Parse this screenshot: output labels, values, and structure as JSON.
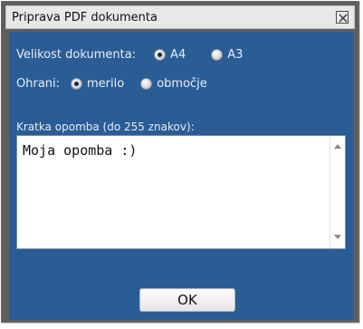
{
  "dialog": {
    "title": "Priprava PDF dokumenta"
  },
  "size": {
    "label": "Velikost dokumenta:",
    "options": [
      {
        "label": "A4",
        "checked": true
      },
      {
        "label": "A3",
        "checked": false
      }
    ]
  },
  "keep": {
    "label": "Ohrani:",
    "options": [
      {
        "label": "merilo",
        "checked": true
      },
      {
        "label": "območje",
        "checked": false
      }
    ]
  },
  "note": {
    "label": "Kratka opomba (do 255 znakov):",
    "value": "Moja opomba :)"
  },
  "buttons": {
    "ok_label": "OK"
  },
  "colors": {
    "panel_bg": "#2a5c95",
    "frame_bg": "#5f5f5f",
    "titlebar_bg": "#e8e8e8"
  }
}
